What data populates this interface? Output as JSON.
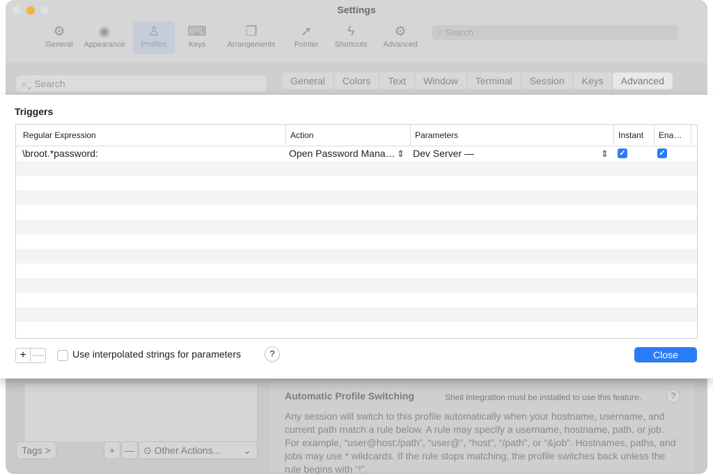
{
  "window": {
    "title": "Settings"
  },
  "toolbar": {
    "items": [
      {
        "label": "General",
        "icon": "gear-icon",
        "glyph": "⚙"
      },
      {
        "label": "Appearance",
        "icon": "eye-icon",
        "glyph": "◉"
      },
      {
        "label": "Profiles",
        "icon": "person-icon",
        "glyph": "♙"
      },
      {
        "label": "Keys",
        "icon": "keyboard-icon",
        "glyph": "⌨"
      },
      {
        "label": "Arrangements",
        "icon": "windows-icon",
        "glyph": "❐"
      },
      {
        "label": "Pointer",
        "icon": "pointer-icon",
        "glyph": "➚"
      },
      {
        "label": "Shortcuts",
        "icon": "bolt-icon",
        "glyph": "ϟ"
      },
      {
        "label": "Advanced",
        "icon": "gears-icon",
        "glyph": "⚙"
      }
    ],
    "selected": "Profiles",
    "search_placeholder": "Search"
  },
  "profiles_search": {
    "placeholder": "Search"
  },
  "profile_tabs": [
    "General",
    "Colors",
    "Text",
    "Window",
    "Terminal",
    "Session",
    "Keys",
    "Advanced"
  ],
  "profile_tab_selected": "Advanced",
  "triggers": {
    "title": "Triggers",
    "columns": [
      "Regular Expression",
      "Action",
      "Parameters",
      "Instant",
      "Ena…"
    ],
    "rows": [
      {
        "regex": "\\broot.*password:",
        "action": "Open Password Mana…",
        "parameters": "Dev Server  —",
        "instant": true,
        "enabled": true
      }
    ],
    "add_label": "+",
    "remove_label": "—",
    "interpolated_label": "Use interpolated strings for parameters",
    "interpolated_checked": false,
    "help_label": "?",
    "close_label": "Close"
  },
  "profile_bottom": {
    "tags_label": "Tags >",
    "add_label": "+",
    "remove_label": "—",
    "other_actions_label": "Other Actions...",
    "aps_title": "Automatic Profile Switching",
    "aps_note": "Shell Integration must be installed to use this feature.",
    "aps_help": "?",
    "aps_body": "Any session will switch to this profile automatically when your hostname, username, and current path match a rule below. A rule may specify a username, hostname, path, or job. For example, “user@host:/path”, “user@”, “host”, “/path”, or “&job”. Hostnames, paths, and jobs may use * wildcards. If the rule stops matching, the profile switches back unless the rule begins with “!”."
  },
  "colors": {
    "accent": "#2a7cf6"
  }
}
